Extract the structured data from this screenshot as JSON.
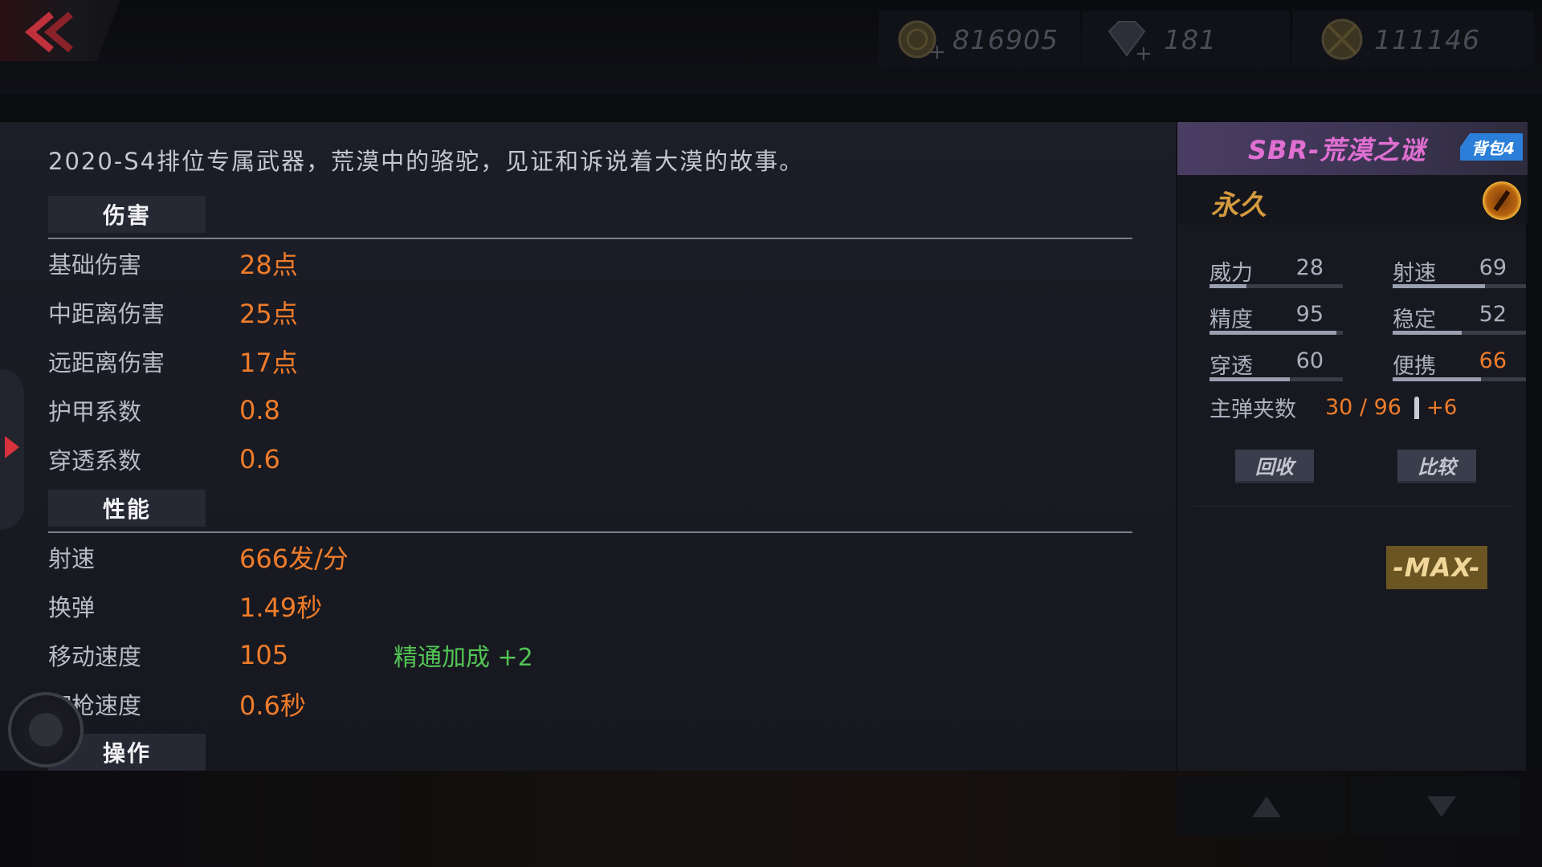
{
  "topbar": {
    "currencies": [
      {
        "icon": "gold-coin-icon",
        "value": "816905"
      },
      {
        "icon": "diamond-icon",
        "value": "181"
      },
      {
        "icon": "medal-icon",
        "value": "111146"
      }
    ]
  },
  "description": "2020-S4排位专属武器，荒漠中的骆驼，见证和诉说着大漠的故事。",
  "sections": {
    "damage": {
      "title": "伤害",
      "rows": [
        {
          "label": "基础伤害",
          "value": "28点"
        },
        {
          "label": "中距离伤害",
          "value": "25点"
        },
        {
          "label": "远距离伤害",
          "value": "17点"
        },
        {
          "label": "护甲系数",
          "value": "0.8"
        },
        {
          "label": "穿透系数",
          "value": "0.6"
        }
      ]
    },
    "performance": {
      "title": "性能",
      "rows": [
        {
          "label": "射速",
          "value": "666发/分"
        },
        {
          "label": "换弹",
          "value": "1.49秒"
        },
        {
          "label": "移动速度",
          "value": "105",
          "bonus": "精通加成 +2"
        },
        {
          "label": "切枪速度",
          "value": "0.6秒"
        }
      ]
    },
    "operation": {
      "title": "操作"
    }
  },
  "weapon": {
    "name": "SBR-荒漠之谜",
    "bag_tag": "背包4",
    "duration": "永久",
    "stats": [
      {
        "label": "威力",
        "value": "28",
        "level": 0.28,
        "highlight": false
      },
      {
        "label": "射速",
        "value": "69",
        "level": 0.69,
        "highlight": false
      },
      {
        "label": "精度",
        "value": "95",
        "level": 0.95,
        "highlight": false
      },
      {
        "label": "稳定",
        "value": "52",
        "level": 0.52,
        "highlight": false
      },
      {
        "label": "穿透",
        "value": "60",
        "level": 0.6,
        "highlight": false
      },
      {
        "label": "便携",
        "value": "66",
        "level": 0.66,
        "highlight": true
      }
    ],
    "ammo": {
      "label": "主弹夹数",
      "value": "30 / 96",
      "extra": "+6"
    },
    "buttons": {
      "recycle": "回收",
      "compare": "比较"
    },
    "max_badge": "-MAX-"
  },
  "colors": {
    "accent_orange": "#ef7c2a",
    "bonus_green": "#52c455",
    "weapon_name_pink": "#e06fd2",
    "bag_tag_blue": "#2b7fd8"
  }
}
